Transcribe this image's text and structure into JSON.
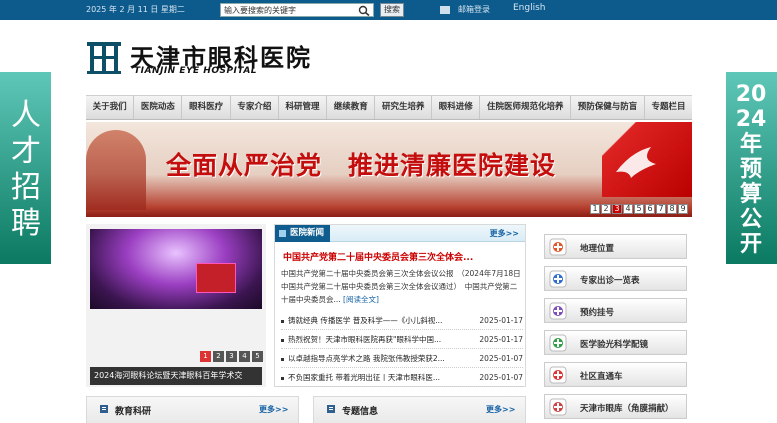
{
  "topbar": {
    "date": "2025 年 2 月 11 日 星期二",
    "search_placeholder": "输入要搜索的关键字",
    "search_button": "搜索",
    "mail_login": "邮箱登录",
    "english": "English"
  },
  "logo": {
    "name_cn": "天津市眼科医院",
    "name_en": "TIANJIN EYE HOSPITAL"
  },
  "nav": {
    "items": [
      "关于我们",
      "医院动态",
      "眼科医疗",
      "专家介绍",
      "科研管理",
      "继续教育",
      "研究生培养",
      "眼科进修",
      "住院医师规范化培养",
      "预防保健与防盲",
      "专题栏目"
    ]
  },
  "side_banners": {
    "left": "人才招聘",
    "right": "2024年预算公开"
  },
  "hero": {
    "slogan": "全面从严治党　推进清廉医院建设",
    "pages": [
      "1",
      "2",
      "3",
      "4",
      "5",
      "6",
      "7",
      "8",
      "9"
    ],
    "active_page": 3
  },
  "photo_news": {
    "caption": "2024海河眼科论坛暨天津眼科百年学术交",
    "pages": [
      "1",
      "2",
      "3",
      "4",
      "5"
    ],
    "active_page": 1
  },
  "news": {
    "tab": "医院新闻",
    "more": "更多>>",
    "headline": "中国共产党第二十届中央委员会第三次全体会...",
    "summary": "中国共产党第二十届中央委员会第三次全体会议公报　（2024年7月18日中国共产党第二十届中央委员会第三次全体会议通过）　中国共产党第二十届中央委员会...",
    "read_full": "[阅读全文]",
    "items": [
      {
        "title": "铸就经典 传播医学 普及科学——《小儿斜视...",
        "date": "2025-01-17"
      },
      {
        "title": "热烈祝贺！天津市眼科医院再获\"眼科学中国...",
        "date": "2025-01-17"
      },
      {
        "title": "以卓越指导点亮学术之路 我院张伟教授荣获2...",
        "date": "2025-01-07"
      },
      {
        "title": "不负国家重托 带着光明出征丨天津市眼科医...",
        "date": "2025-01-07"
      }
    ]
  },
  "quick_links": [
    {
      "label": "地理位置",
      "icon": "map-pin-icon",
      "color": "#e0572b"
    },
    {
      "label": "专家出诊一览表",
      "icon": "doctor-icon",
      "color": "#2f6ecf"
    },
    {
      "label": "预约挂号",
      "icon": "clipboard-icon",
      "color": "#7c4fb8"
    },
    {
      "label": "医学验光科学配镜",
      "icon": "medical-cross-icon",
      "color": "#2f9e44"
    },
    {
      "label": "社区直通车",
      "icon": "ambulance-icon",
      "color": "#d33"
    },
    {
      "label": "天津市眼库（角膜捐献）",
      "icon": "eye-bank-icon",
      "color": "#c44"
    }
  ],
  "sections": {
    "edu": {
      "title": "教育科研",
      "more": "更多>>"
    },
    "special": {
      "title": "专题信息",
      "more": "更多>>"
    }
  },
  "colors": {
    "topbar": "#0d5a8c",
    "accent_red": "#c40d0d",
    "side_banner": "#0b7a62",
    "link": "#1561a4"
  }
}
